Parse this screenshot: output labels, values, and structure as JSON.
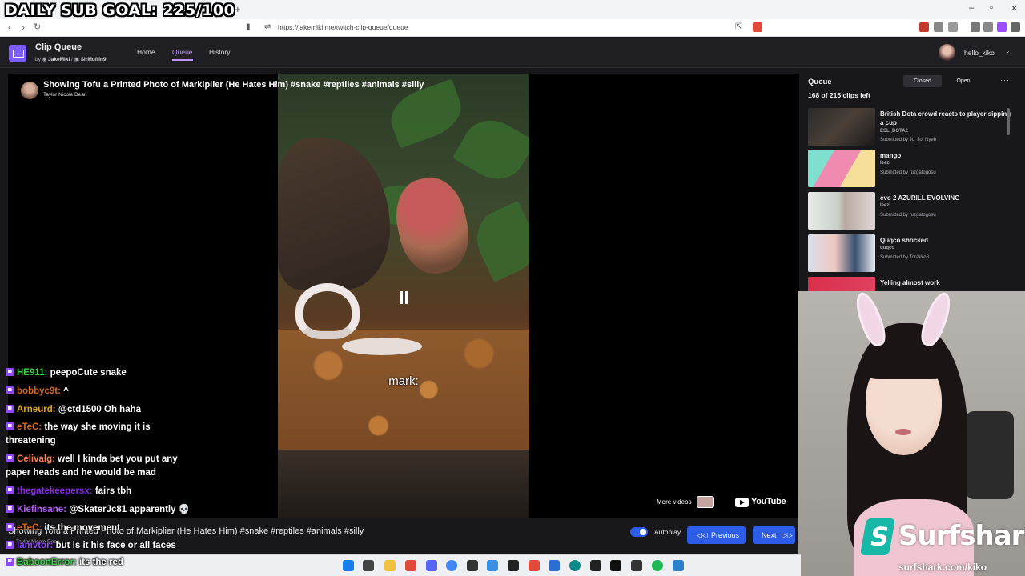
{
  "browser": {
    "overlay_goal": "DAILY SUB GOAL: 225/100",
    "new_tab": "+",
    "url": "https://jakemiki.me/twitch-clip-queue/queue",
    "win_min": "–",
    "win_max": "▫",
    "win_close": "✕"
  },
  "app": {
    "name": "Clip Queue",
    "by": "by",
    "author1": "JakeMiki",
    "separator": "/",
    "author2": "SirMuffin9",
    "nav": {
      "home": "Home",
      "queue": "Queue",
      "history": "History"
    },
    "username": "hello_kiko"
  },
  "player": {
    "title": "Showing Tofu a Printed Photo of Markiplier (He Hates Him) #snake #reptiles #animals #silly",
    "channel": "Taylor Nicole Dean",
    "subtitle": "mark:",
    "more_videos": "More videos",
    "youtube": "YouTube"
  },
  "controls": {
    "title": "Showing Tofu a Printed Photo of Markiplier (He Hates Him) #snake #reptiles #animals #silly",
    "channel": "Taylor Nicole Dean",
    "autoplay": "Autoplay",
    "previous": "Previous",
    "next": "Next"
  },
  "chat": [
    {
      "user": "HE911:",
      "color": "#3fd046",
      "text": "peepoCute snake"
    },
    {
      "user": "bobbyc9t:",
      "color": "#d2691e",
      "text": "^"
    },
    {
      "user": "Arneurd:",
      "color": "#daa520",
      "text": "@ctd1500 Oh haha"
    },
    {
      "user": "eTeC:",
      "color": "#d2691e",
      "text": "the way she moving it is threatening"
    },
    {
      "user": "Celivalg:",
      "color": "#ff7f50",
      "text": "well I kinda bet you put any paper heads and he would be mad"
    },
    {
      "user": "thegatekeepersx:",
      "color": "#8a2be2",
      "text": "fairs tbh"
    },
    {
      "user": "Kiefinsane:",
      "color": "#b05cf0",
      "text": "@SkaterJc81 apparently 💀"
    },
    {
      "user": "eTeC:",
      "color": "#d2691e",
      "text": "its the movement"
    },
    {
      "user": "lamvtor:",
      "color": "#9147ff",
      "text": "but is it his face or all faces"
    }
  ],
  "bottom_chat": {
    "user": "BaboonError:",
    "color": "#3fd046",
    "text": "its the red"
  },
  "queue": {
    "title": "Queue",
    "closed": "Closed",
    "open": "Open",
    "more": "···",
    "count": "168 of 215 clips left",
    "items": [
      {
        "name": "British Dota crowd reacts to player sipping a cup",
        "channel": "ESL_DOTA2",
        "submitted": "Submitted by Jo_Jo_Nyeb"
      },
      {
        "name": "mango",
        "channel": "leezi",
        "submitted": "Submitted by ruzgatogosu"
      },
      {
        "name": "evo 2 AZURILL EVOLVING",
        "channel": "leezi",
        "submitted": "Submitted by ruzgatogosu"
      },
      {
        "name": "Quqco shocked",
        "channel": "quqco",
        "submitted": "Submitted by Torakko8"
      },
      {
        "name": "Yelling almost work",
        "channel": "",
        "submitted": ""
      }
    ]
  },
  "sponsor": {
    "name": "Surfshark",
    "url": "surfshark.com/kiko",
    "color": "#17b8a8"
  },
  "colors": {
    "accent": "#bf94ff",
    "button": "#2c5ce8",
    "twitch_purple": "#9147ff"
  }
}
